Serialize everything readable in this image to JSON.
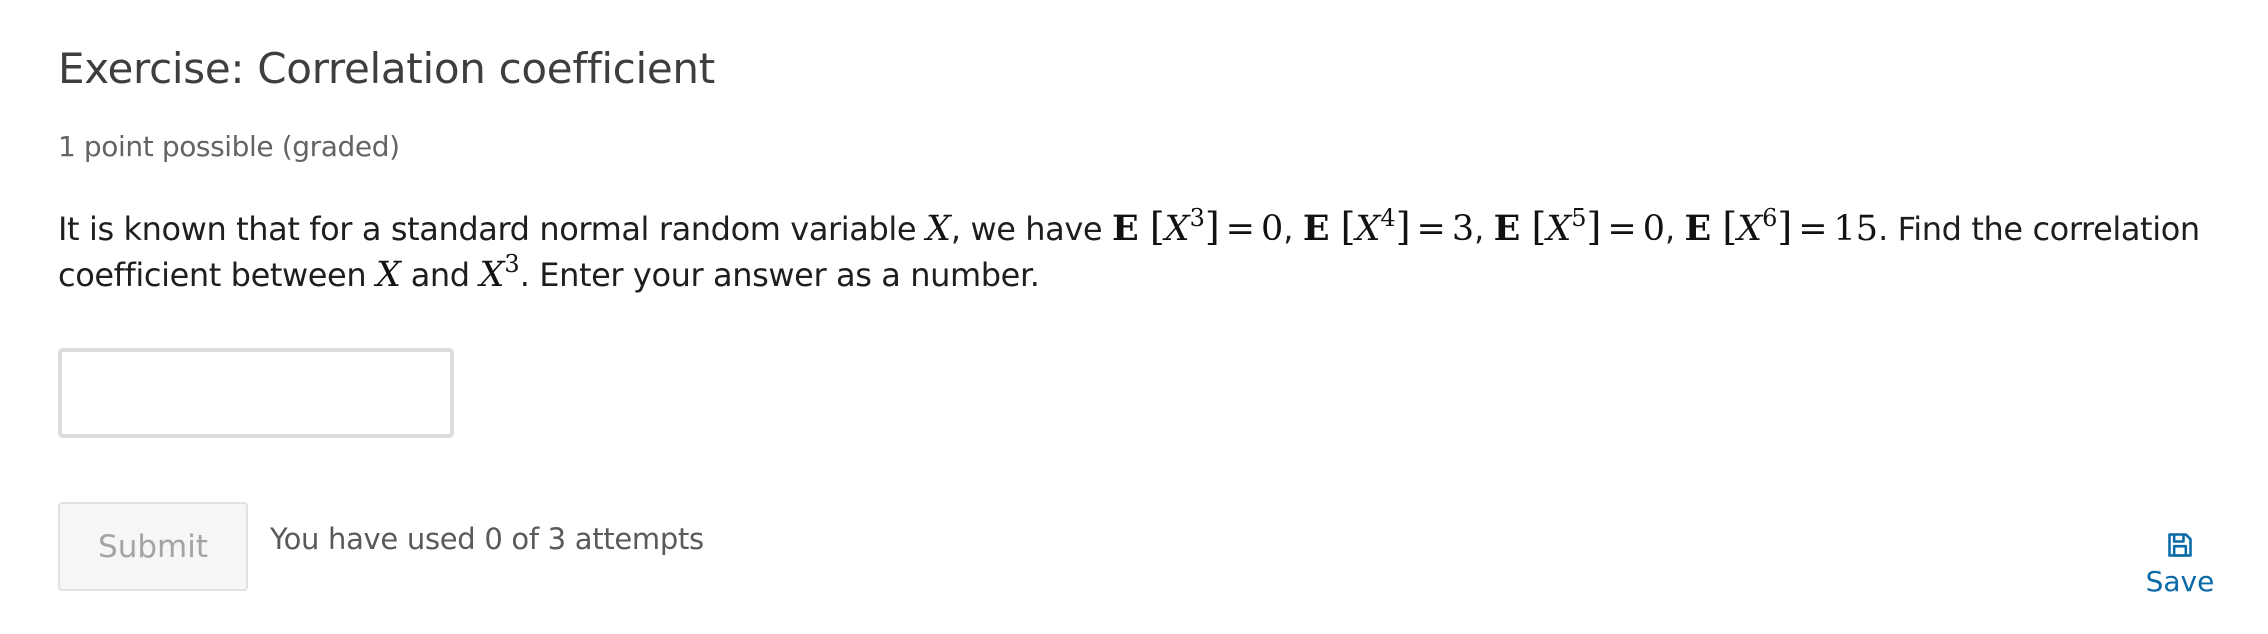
{
  "exercise": {
    "title": "Exercise: Correlation coefficient",
    "points": "1 point possible (graded)"
  },
  "problem": {
    "text_1": "It is known that for a standard normal random variable ",
    "var_x": "X",
    "text_2": ", we have ",
    "expectation_symbol": "E",
    "expectations": [
      {
        "power": "3",
        "value": "0"
      },
      {
        "power": "4",
        "value": "3"
      },
      {
        "power": "5",
        "value": "0"
      },
      {
        "power": "6",
        "value": "15"
      }
    ],
    "text_3": ". Find the correlation",
    "text_4": "coefficient between ",
    "text_5": " and ",
    "cube_power": "3",
    "text_6": ". Enter your answer as a number."
  },
  "answer": {
    "value": "",
    "placeholder": ""
  },
  "actions": {
    "submit_label": "Submit",
    "attempts_text": "You have used 0 of 3 attempts",
    "save_label": "Save",
    "save_icon": "floppy-disk-icon"
  },
  "colors": {
    "link": "#0a6aa8",
    "submit_disabled_text": "#a4a4a4"
  }
}
